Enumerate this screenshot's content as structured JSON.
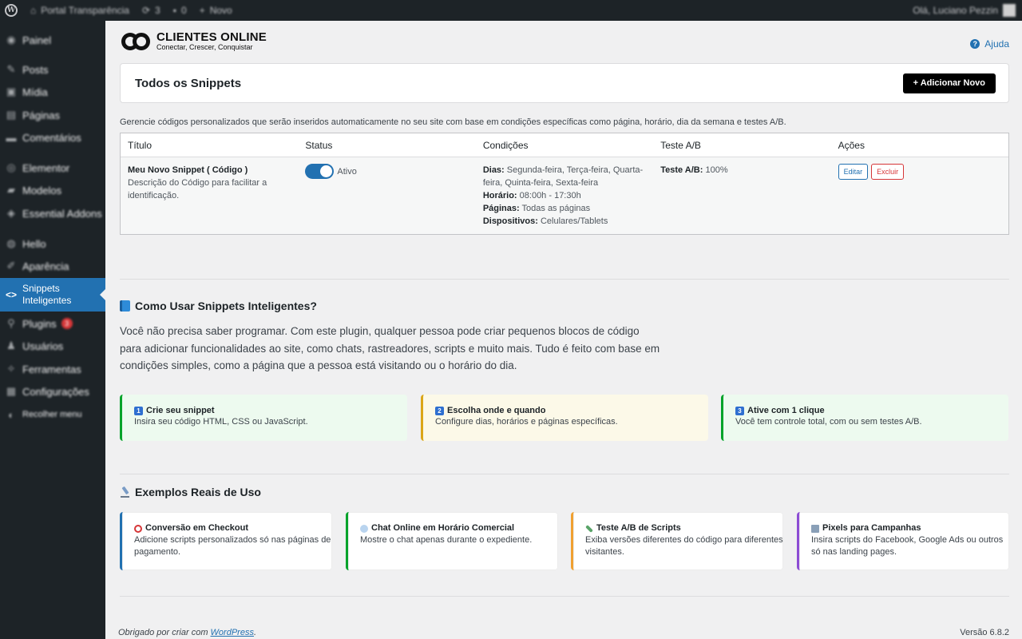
{
  "admin_bar": {
    "site_name": "Portal Transparência",
    "updates_count": "3",
    "comments_count": "0",
    "new_label": "Novo",
    "greeting": "Olá, Luciano Pezzin"
  },
  "sidebar": {
    "items": [
      {
        "label": "Painel",
        "icon": "gauge-icon"
      },
      {
        "label": "Posts",
        "icon": "pin-icon"
      },
      {
        "label": "Mídia",
        "icon": "media-icon"
      },
      {
        "label": "Páginas",
        "icon": "page-icon"
      },
      {
        "label": "Comentários",
        "icon": "comment-icon"
      },
      {
        "label": "Elementor",
        "icon": "elementor-icon"
      },
      {
        "label": "Modelos",
        "icon": "folder-icon"
      },
      {
        "label": "Essential Addons",
        "icon": "addons-icon"
      },
      {
        "label": "Hello",
        "icon": "hello-icon"
      },
      {
        "label": "Aparência",
        "icon": "brush-icon"
      },
      {
        "label": "Snippets Inteligentes",
        "icon": "code-icon"
      },
      {
        "label": "Plugins",
        "icon": "plug-icon",
        "badge": "3"
      },
      {
        "label": "Usuários",
        "icon": "user-icon"
      },
      {
        "label": "Ferramentas",
        "icon": "wrench-icon"
      },
      {
        "label": "Configurações",
        "icon": "settings-icon"
      },
      {
        "label": "Recolher menu",
        "icon": "collapse-icon"
      }
    ]
  },
  "logo": {
    "title": "CLIENTES ONLINE",
    "subtitle": "Conectar, Crescer, Conquistar"
  },
  "help_label": "Ajuda",
  "header": {
    "title": "Todos os Snippets",
    "add_button": "+ Adicionar Novo"
  },
  "description": "Gerencie códigos personalizados que serão inseridos automaticamente no seu site com base em condições específicas como página, horário, dia da semana e testes A/B.",
  "table": {
    "columns": [
      "Título",
      "Status",
      "Condições",
      "Teste A/B",
      "Ações"
    ],
    "row": {
      "title": "Meu Novo Snippet ( Código )",
      "subtitle": "Descrição do Código para facilitar a identificação.",
      "status": "Ativo",
      "conditions": {
        "days_label": "Dias:",
        "days_value": "Segunda-feira, Terça-feira, Quarta-feira, Quinta-feira, Sexta-feira",
        "time_label": "Horário:",
        "time_value": "08:00h - 17:30h",
        "pages_label": "Páginas:",
        "pages_value": "Todas as páginas",
        "devices_label": "Dispositivos:",
        "devices_value": "Celulares/Tablets"
      },
      "ab_label": "Teste A/B:",
      "ab_value": "100%",
      "edit_label": "Editar",
      "delete_label": "Excluir"
    }
  },
  "how_to": {
    "title": "Como Usar Snippets Inteligentes?",
    "intro": "Você não precisa saber programar. Com este plugin, qualquer pessoa pode criar pequenos blocos de código para adicionar funcionalidades ao site, como chats, rastreadores, scripts e muito mais. Tudo é feito com base em condições simples, como a página que a pessoa está visitando ou o horário do dia.",
    "steps": [
      {
        "num": "1",
        "title": "Crie seu snippet",
        "desc": "Insira seu código HTML, CSS ou JavaScript.",
        "color": "#00a32a",
        "bg": "#edfaef"
      },
      {
        "num": "2",
        "title": "Escolha onde e quando",
        "desc": "Configure dias, horários e páginas específicas.",
        "color": "#dba617",
        "bg": "#fcf9e8"
      },
      {
        "num": "3",
        "title": "Ative com 1 clique",
        "desc": "Você tem controle total, com ou sem testes A/B.",
        "color": "#00a32a",
        "bg": "#edfaef"
      }
    ]
  },
  "examples": {
    "title": "Exemplos Reais de Uso",
    "items": [
      {
        "title": "Conversão em Checkout",
        "desc": "Adicione scripts personalizados só nas páginas de pagamento.",
        "color": "#2271b1",
        "icon": "target-icon",
        "icon_color": "#d63638"
      },
      {
        "title": "Chat Online em Horário Comercial",
        "desc": "Mostre o chat apenas durante o expediente.",
        "color": "#00a32a",
        "icon": "speech-bubble-icon",
        "icon_color": "#8ab4e0"
      },
      {
        "title": "Teste A/B de Scripts",
        "desc": "Exiba versões diferentes do código para diferentes visitantes.",
        "color": "#f0a030",
        "icon": "test-tube-icon",
        "icon_color": "#5aa469"
      },
      {
        "title": "Pixels para Campanhas",
        "desc": "Insira scripts do Facebook, Google Ads ou outros só nas landing pages.",
        "color": "#8c4cd4",
        "icon": "bar-chart-icon",
        "icon_color": "#6b7a8c"
      }
    ]
  },
  "footer": {
    "thanks_prefix": "Obrigado por criar com ",
    "thanks_link": "WordPress",
    "thanks_suffix": ".",
    "version": "Versão 6.8.2"
  }
}
